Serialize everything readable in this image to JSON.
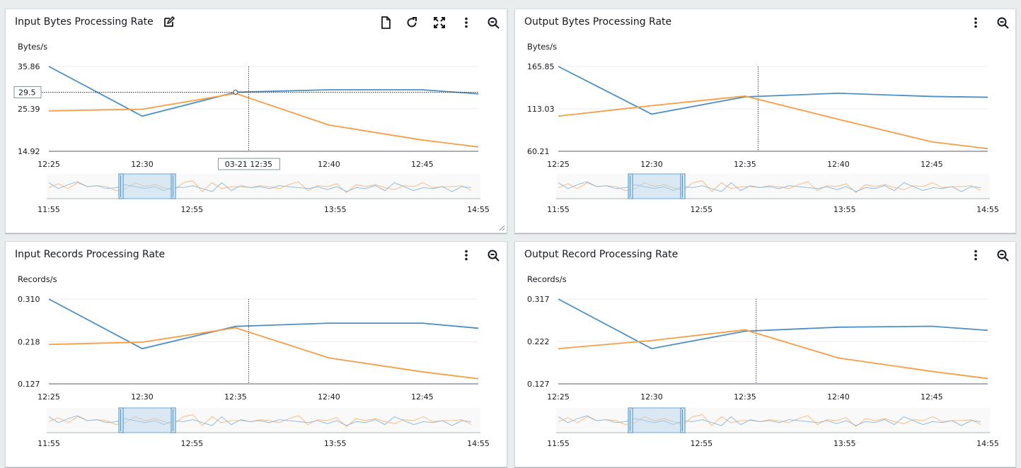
{
  "colors": {
    "blue": "#4b8fc6",
    "orange": "#f89d43",
    "grid": "#e9ebed",
    "axis": "#545b64"
  },
  "panels": [
    {
      "title": "Input Bytes Processing Rate",
      "unit": "Bytes/s",
      "icons": [
        "edit-icon",
        "document-icon",
        "refresh-icon",
        "expand-icon",
        "more-options-icon",
        "zoom-out-icon"
      ],
      "tooltip_value": "29.5",
      "tooltip_time": "03-21 12:35",
      "chart_data": {
        "type": "line",
        "x": [
          "12:25",
          "12:30",
          "12:35",
          "12:40",
          "12:45",
          "12:48"
        ],
        "xticks": [
          "12:25",
          "12:30",
          "12:35",
          "12:40",
          "12:45"
        ],
        "ylim": [
          14.92,
          35.86
        ],
        "yticks": [
          "35.86",
          "25.39",
          "14.92"
        ],
        "series": [
          {
            "color": "blue",
            "values": [
              35.86,
              23.6,
              29.5,
              30.1,
              30.1,
              29.1
            ]
          },
          {
            "color": "orange",
            "values": [
              24.9,
              25.3,
              29.2,
              21.4,
              17.7,
              16.0
            ]
          }
        ],
        "cursor_x": "12:35.7",
        "nav_xticks": [
          "11:55",
          "12:55",
          "13:55",
          "14:55"
        ]
      }
    },
    {
      "title": "Output Bytes Processing Rate",
      "unit": "Bytes/s",
      "icons": [
        "more-options-icon",
        "zoom-out-icon"
      ],
      "chart_data": {
        "type": "line",
        "x": [
          "12:25",
          "12:30",
          "12:35",
          "12:40",
          "12:45",
          "12:48"
        ],
        "xticks": [
          "12:25",
          "12:30",
          "12:35",
          "12:40",
          "12:45"
        ],
        "ylim": [
          60.21,
          165.85
        ],
        "yticks": [
          "165.85",
          "113.03",
          "60.21"
        ],
        "series": [
          {
            "color": "blue",
            "values": [
              165.85,
              106.5,
              128.0,
              132.5,
              128.5,
              127.5
            ]
          },
          {
            "color": "orange",
            "values": [
              104.0,
              117.0,
              129.0,
              100.0,
              72.0,
              63.5
            ]
          }
        ],
        "cursor_x": "12:35.7",
        "nav_xticks": [
          "11:55",
          "12:55",
          "13:55",
          "14:55"
        ]
      }
    },
    {
      "title": "Input Records Processing Rate",
      "unit": "Records/s",
      "icons": [
        "more-options-icon",
        "zoom-out-icon"
      ],
      "chart_data": {
        "type": "line",
        "x": [
          "12:25",
          "12:30",
          "12:35",
          "12:40",
          "12:45",
          "12:48"
        ],
        "xticks": [
          "12:25",
          "12:30",
          "12:35",
          "12:40",
          "12:45"
        ],
        "ylim": [
          0.127,
          0.31
        ],
        "yticks": [
          "0.310",
          "0.218",
          "0.127"
        ],
        "series": [
          {
            "color": "blue",
            "values": [
              0.31,
              0.203,
              0.251,
              0.258,
              0.258,
              0.247
            ]
          },
          {
            "color": "orange",
            "values": [
              0.212,
              0.217,
              0.248,
              0.183,
              0.153,
              0.138
            ]
          }
        ],
        "cursor_x": "12:35.7",
        "nav_xticks": [
          "11:55",
          "12:55",
          "13:55",
          "14:55"
        ]
      }
    },
    {
      "title": "Output Record Processing Rate",
      "unit": "Records/s",
      "icons": [
        "more-options-icon",
        "zoom-out-icon"
      ],
      "chart_data": {
        "type": "line",
        "x": [
          "12:25",
          "12:30",
          "12:35",
          "12:40",
          "12:45",
          "12:48"
        ],
        "xticks": [
          "12:25",
          "12:30",
          "12:35",
          "12:40",
          "12:45"
        ],
        "ylim": [
          0.127,
          0.317
        ],
        "yticks": [
          "0.317",
          "0.222",
          "0.127"
        ],
        "series": [
          {
            "color": "blue",
            "values": [
              0.317,
              0.206,
              0.245,
              0.254,
              0.256,
              0.247
            ]
          },
          {
            "color": "orange",
            "values": [
              0.206,
              0.224,
              0.248,
              0.185,
              0.155,
              0.139
            ]
          }
        ],
        "cursor_x": "12:35.6",
        "nav_xticks": [
          "11:55",
          "12:55",
          "13:55",
          "14:55"
        ]
      }
    }
  ]
}
